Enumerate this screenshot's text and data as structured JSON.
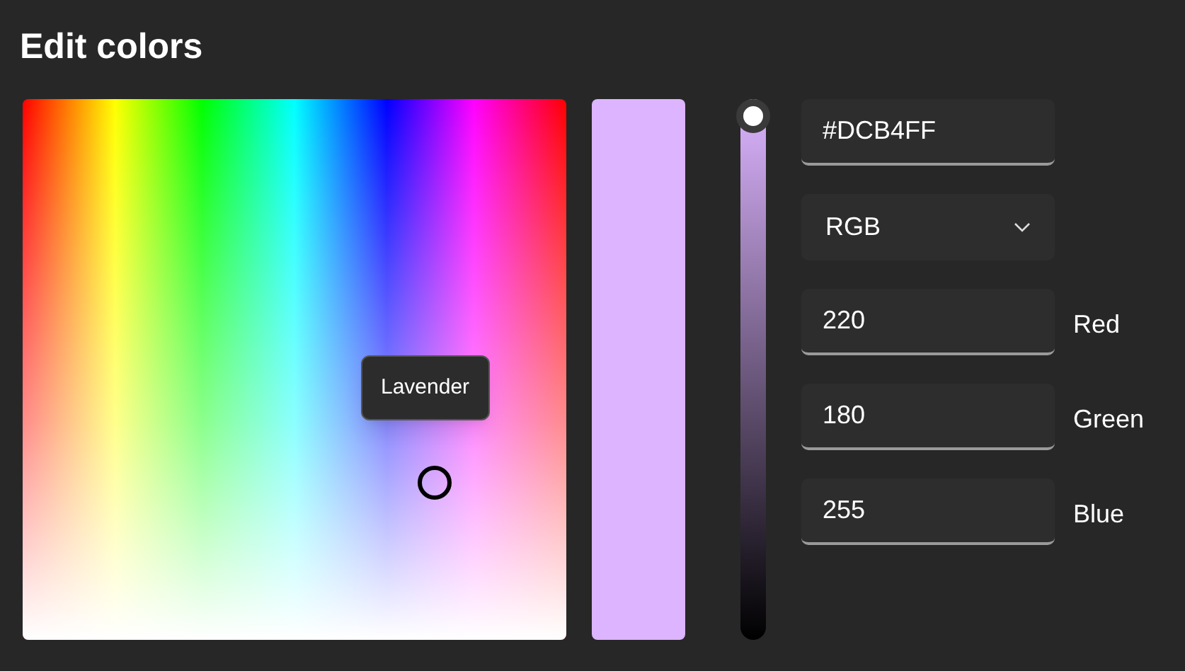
{
  "title": "Edit colors",
  "spectrum": {
    "tooltip": "Lavender"
  },
  "value_slider": {
    "level": 1
  },
  "hex_field": {
    "value": "#DCB4FF"
  },
  "format_dropdown": {
    "value": "RGB"
  },
  "channels": [
    {
      "label": "Red",
      "value": "220"
    },
    {
      "label": "Green",
      "value": "180"
    },
    {
      "label": "Blue",
      "value": "255"
    }
  ]
}
